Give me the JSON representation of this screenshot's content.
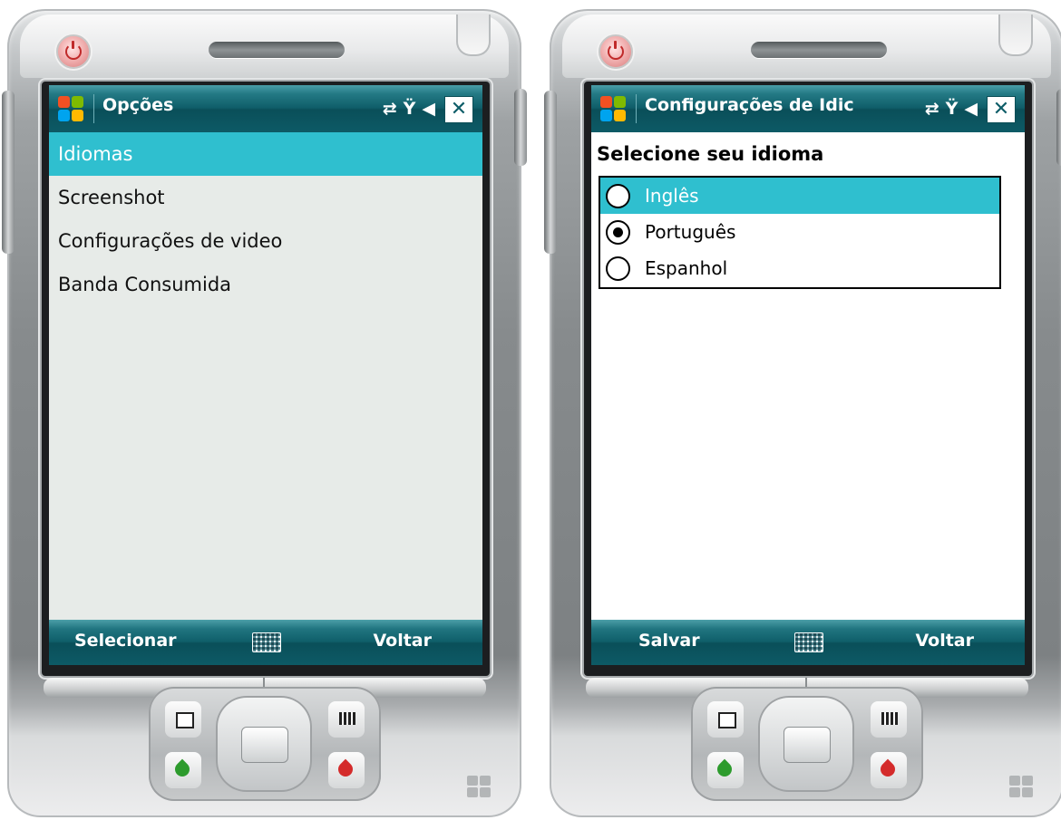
{
  "left_device": {
    "title": "Opções",
    "status_icons": [
      "connectivity-icon",
      "no-signal-icon",
      "speaker-icon"
    ],
    "close_label": "✕",
    "menu_items": [
      {
        "label": "Idiomas",
        "selected": true
      },
      {
        "label": "Screenshot",
        "selected": false
      },
      {
        "label": "Configurações de video",
        "selected": false
      },
      {
        "label": "Banda Consumida",
        "selected": false
      }
    ],
    "softkeys": {
      "left": "Selecionar",
      "right": "Voltar"
    }
  },
  "right_device": {
    "title": "Configurações de Idic",
    "status_icons": [
      "connectivity-icon",
      "no-signal-icon",
      "speaker-icon"
    ],
    "close_label": "✕",
    "heading": "Selecione seu idioma",
    "options": [
      {
        "label": "Inglês",
        "highlighted": true,
        "checked": false
      },
      {
        "label": "Português",
        "highlighted": false,
        "checked": true
      },
      {
        "label": "Espanhol",
        "highlighted": false,
        "checked": false
      }
    ],
    "softkeys": {
      "left": "Salvar",
      "right": "Voltar"
    }
  },
  "colors": {
    "titlebar": "#0f5e69",
    "selection": "#2fbfcf",
    "screen_left": "#e7ebe8",
    "screen_right": "#ffffff"
  }
}
